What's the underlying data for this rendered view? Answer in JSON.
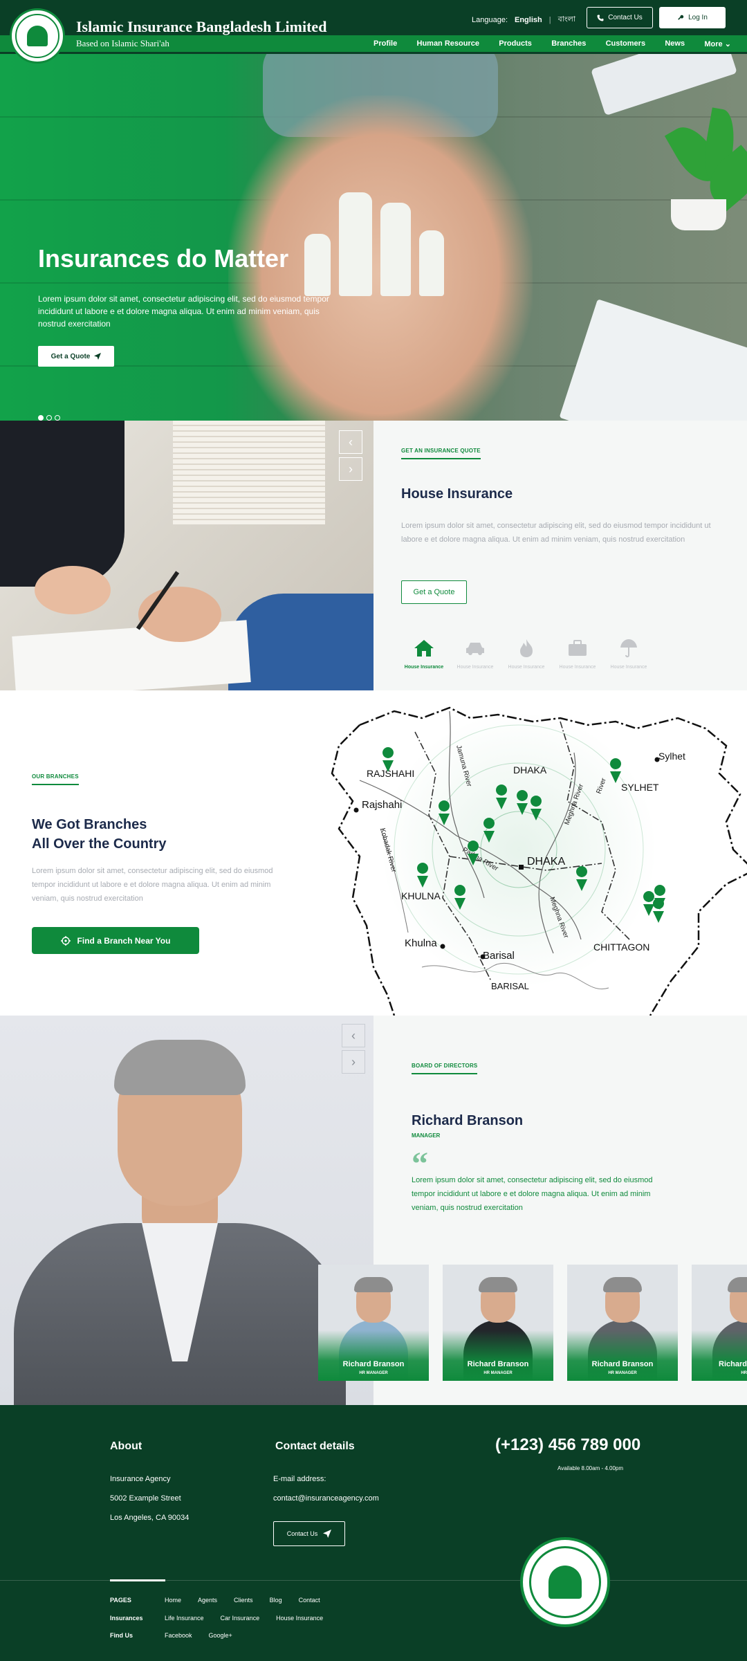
{
  "header": {
    "brand_title": "Islamic Insurance Bangladesh Limited",
    "brand_subtitle": "Based on Islamic Shari'ah",
    "language_label": "Language:",
    "language_english": "English",
    "language_separator": "|",
    "language_bangla": "বাংলা",
    "contact_button": "Contact Us",
    "login_button": "Log In",
    "nav": [
      "Profile",
      "Human Resource",
      "Products",
      "Branches",
      "Customers",
      "News",
      "More"
    ]
  },
  "hero": {
    "title": "Insurances do Matter",
    "text": "Lorem ipsum dolor sit amet, consectetur adipiscing elit, sed do eiusmod tempor incididunt ut labore e et dolore magna aliqua. Ut enim ad minim veniam, quis nostrud exercitation",
    "button": "Get a Quote",
    "slides_total": 3,
    "slide_active": 1
  },
  "quote": {
    "eyebrow": "GET AN INSURANCE QUOTE",
    "title": "House Insurance",
    "text": "Lorem ipsum dolor sit amet, consectetur adipiscing elit, sed do eiusmod tempor incididunt ut labore e et dolore magna aliqua. Ut enim ad minim veniam, quis nostrud exercitation",
    "button": "Get a Quote",
    "tabs": [
      {
        "label": "House Insurance",
        "icon": "house-icon",
        "active": true
      },
      {
        "label": "House Insurance",
        "icon": "car-icon",
        "active": false
      },
      {
        "label": "House Insurance",
        "icon": "fire-icon",
        "active": false
      },
      {
        "label": "House Insurance",
        "icon": "briefcase-icon",
        "active": false
      },
      {
        "label": "House Insurance",
        "icon": "umbrella-icon",
        "active": false
      }
    ]
  },
  "branches": {
    "eyebrow": "OUR BRANCHES",
    "title_line1": "We Got Branches",
    "title_line2": "All Over the Country",
    "text": "Lorem ipsum dolor sit amet, consectetur adipiscing elit, sed do eiusmod tempor incididunt ut labore e et dolore magna aliqua. Ut enim ad minim veniam, quis nostrud exercitation",
    "button": "Find a Branch Near You",
    "map_labels": {
      "rajshahi_div": "RAJSHAHI",
      "rajshahi": "Rajshahi",
      "dhaka_div": "DHAKA",
      "dhaka": "DHAKA",
      "sylhet_div": "SYLHET",
      "sylhet": "Sylhet",
      "khulna_div": "KHULNA",
      "khulna": "Khulna",
      "barisal": "Barisal",
      "barisal_div": "BARISAL",
      "chittagong": "CHITTAGON",
      "jamuna": "Jamuna River",
      "padma": "Padma River",
      "meghna": "Meghna River",
      "kobadak": "Kobadak River",
      "river": "River"
    }
  },
  "board": {
    "eyebrow": "BOARD OF DIRECTORS",
    "name": "Richard Branson",
    "role": "MANAGER",
    "quote": "Lorem ipsum dolor sit amet, consectetur adipiscing elit, sed do eiusmod tempor incididunt ut labore e et dolore magna aliqua. Ut enim ad minim veniam, quis nostrud exercitation",
    "members": [
      {
        "name": "Richard Branson",
        "role": "HR MANAGER",
        "suit": "#8fb3cf"
      },
      {
        "name": "Richard Branson",
        "role": "HR MANAGER",
        "suit": "#23262b"
      },
      {
        "name": "Richard Branson",
        "role": "HR MANAGER",
        "suit": "#5f6369"
      },
      {
        "name": "Richard",
        "role": "HR",
        "suit": "#5f6369"
      }
    ]
  },
  "footer": {
    "about_title": "About",
    "about_lines": [
      "Insurance Agency",
      "5002 Example Street",
      "Los Angeles, CA 90034"
    ],
    "contact_title": "Contact details",
    "email_label": "E-mail address:",
    "email": "contact@insuranceagency.com",
    "contact_button": "Contact Us",
    "phone": "(+123) 456 789 000",
    "hours": "Available 8.00am - 4.00pm",
    "rows": [
      {
        "key": "PAGES",
        "values": [
          "Home",
          "Agents",
          "Clients",
          "Blog",
          "Contact"
        ]
      },
      {
        "key": "Insurances",
        "values": [
          "Life Insurance",
          "Car Insurance",
          "House Insurance"
        ]
      },
      {
        "key": "Find Us",
        "values": [
          "Facebook",
          "Google+"
        ]
      }
    ]
  },
  "colors": {
    "brand_dark": "#0a3f26",
    "brand_green": "#0f8a3c",
    "heading_navy": "#1c2a4a",
    "muted_text": "#a7abb2"
  }
}
